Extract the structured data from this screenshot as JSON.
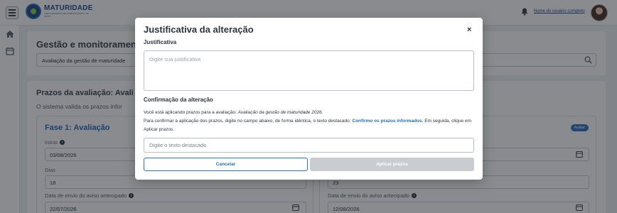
{
  "header": {
    "logo_title": "MATURIDADE",
    "logo_subtitle": "PARA PROCESSO DE GERENCIAMENTO DE RISCO",
    "user_name": "Nome do usuário completo"
  },
  "page": {
    "section_title": "Gestão e monitoramento",
    "select_value": "Avaliação da gestão de maturidade",
    "deadlines_title": "Prazos da avaliação: Avali",
    "deadlines_subtitle": "O sistema valida os prazos infor",
    "phase_title": "Fase 1: Avaliação",
    "phase_badge": "Avaliar",
    "left_fields": [
      {
        "label": "Início",
        "value": "03/08/2026"
      },
      {
        "label": "Dias",
        "value": "18"
      },
      {
        "label": "Data de envio do aviso antecipado",
        "value": "22/07/2026"
      }
    ],
    "right_fields": [
      {
        "label": "",
        "value": ""
      },
      {
        "label": "",
        "value": "23"
      },
      {
        "label": "Data de envio do aviso antecipado",
        "value": "12/08/2026"
      }
    ]
  },
  "modal": {
    "title": "Justificativa da alteração",
    "close_label": "×",
    "justification_label": "Justificativa",
    "justification_placeholder": "Digite sua justificativa",
    "confirmation_label": "Confirmação da alteração",
    "text_intro": "Você está aplicando prazos para a avaliação: ",
    "evaluation_name": "Avaliação da gestão de maturidade 2026",
    "text_period": ".",
    "text_instructions": "Para confirmar a aplicação dos prazos, digite no campo abaixo, de forma idêntica, o texto destacado: ",
    "highlighted_text": "Confirmo os prazos informados",
    "text_after": ". Em seguida, clique em Aplicar prazos.",
    "confirm_placeholder": "Digite o texto destacado",
    "cancel_label": "Cancelar",
    "apply_label": "Aplicar prazos"
  },
  "colors": {
    "accent": "#2f74c0",
    "accent_text": "#1f6fb8",
    "disabled": "#c9ccd0",
    "overlay": "rgba(20,24,30,0.5)"
  }
}
